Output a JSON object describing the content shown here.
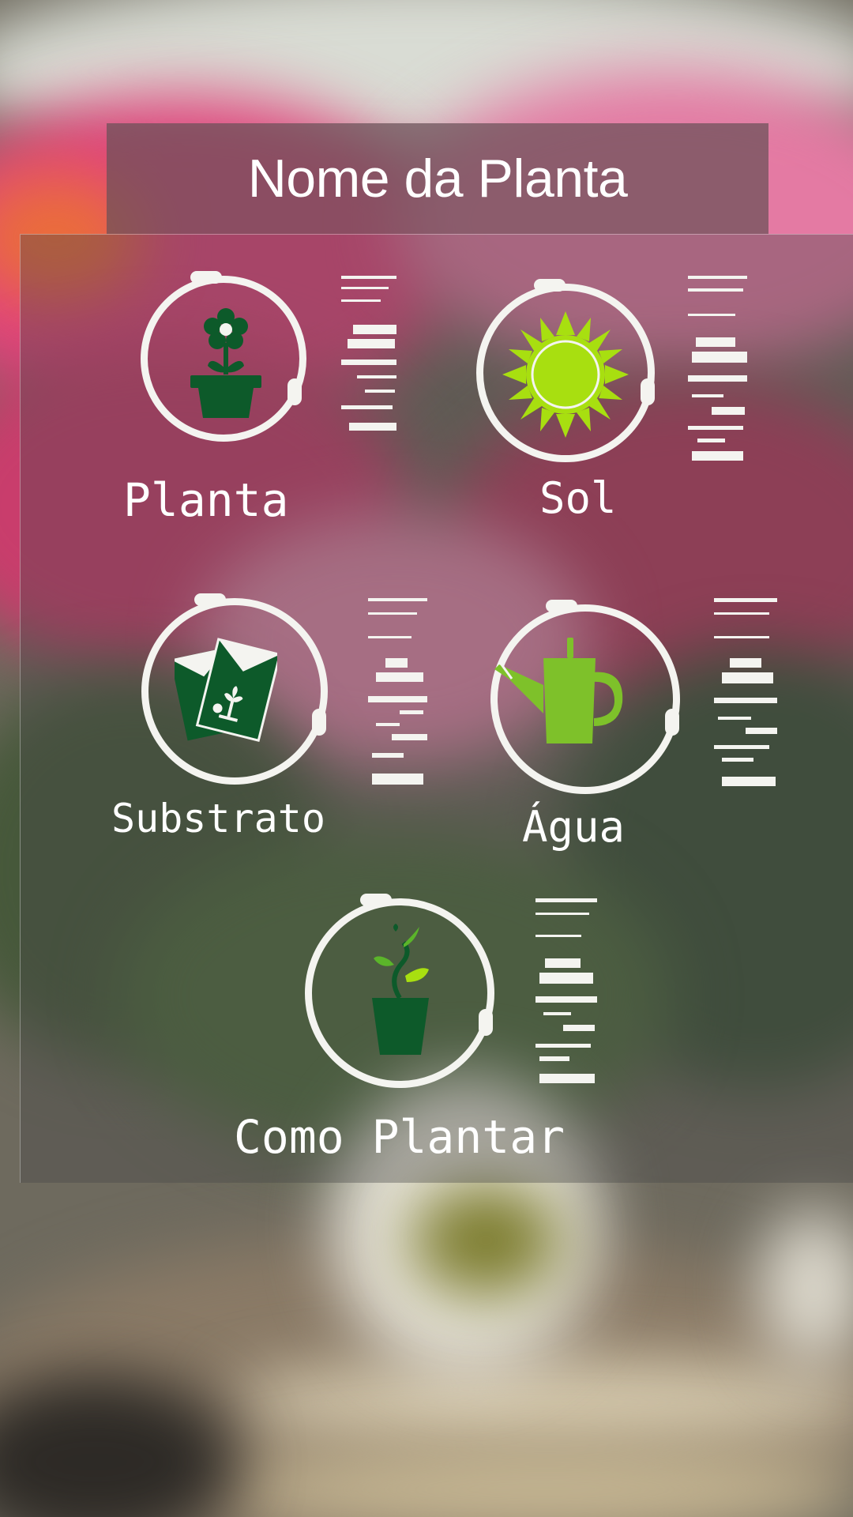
{
  "header": {
    "title": "Nome da Planta"
  },
  "items": [
    {
      "label": "Planta",
      "icon": "potted-flower-icon"
    },
    {
      "label": "Sol",
      "icon": "sun-icon"
    },
    {
      "label": "Substrato",
      "icon": "seed-packet-icon"
    },
    {
      "label": "Água",
      "icon": "watering-can-icon"
    },
    {
      "label": "Como Plantar",
      "icon": "sprout-pot-icon"
    }
  ],
  "colors": {
    "dark_green": "#0d5a2a",
    "lime": "#a8df10",
    "watering_can_green": "#7ec12a",
    "ring": "#f4f4f0"
  }
}
